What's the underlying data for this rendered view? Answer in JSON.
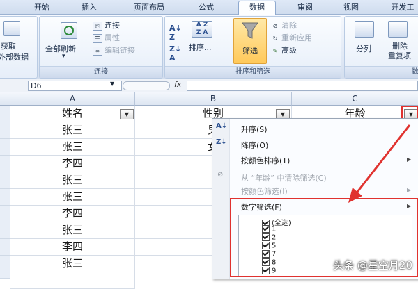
{
  "ribbon": {
    "tabs": [
      "开始",
      "插入",
      "页面布局",
      "公式",
      "数据",
      "审阅",
      "视图",
      "开发工"
    ],
    "active_tab": "数据",
    "groups": {
      "get_external": {
        "label_line1": "获取",
        "label_line2": "外部数据"
      },
      "connections": {
        "refresh_all": "全部刷新",
        "connections": "连接",
        "properties": "属性",
        "edit_links": "编辑链接",
        "group_label": "连接"
      },
      "sort_filter": {
        "sort": "排序...",
        "filter": "筛选",
        "clear": "清除",
        "reapply": "重新应用",
        "advanced": "高级",
        "group_label": "排序和筛选"
      },
      "data_tools": {
        "split": "分列",
        "remove_dup_line1": "删除",
        "remove_dup_line2": "重复项",
        "group_label": "数"
      }
    }
  },
  "formula_bar": {
    "name_box": "D6",
    "fx_label": "fx",
    "formula": ""
  },
  "sheet": {
    "columns": [
      "A",
      "B",
      "C"
    ],
    "headers": [
      "姓名",
      "性别",
      "年龄"
    ],
    "col_a_values": [
      "张三",
      "张三",
      "李四",
      "张三",
      "张三",
      "李四",
      "张三",
      "李四",
      "张三"
    ],
    "col_b_values": [
      "男",
      "女"
    ]
  },
  "filter_menu": {
    "sort_asc": "升序(S)",
    "sort_desc": "降序(O)",
    "sort_by_color": "按颜色排序(T)",
    "clear_filter": "从 “年龄” 中清除筛选(C)",
    "filter_by_color": "按颜色筛选(I)",
    "number_filters": "数字筛选(F)",
    "checklist": [
      "(全选)",
      "1",
      "2",
      "5",
      "7",
      "8",
      "9"
    ]
  },
  "watermark": "头条 @星空月20",
  "colors": {
    "annotation_red": "#e0322f",
    "ribbon_blue": "#dfe9f7"
  }
}
